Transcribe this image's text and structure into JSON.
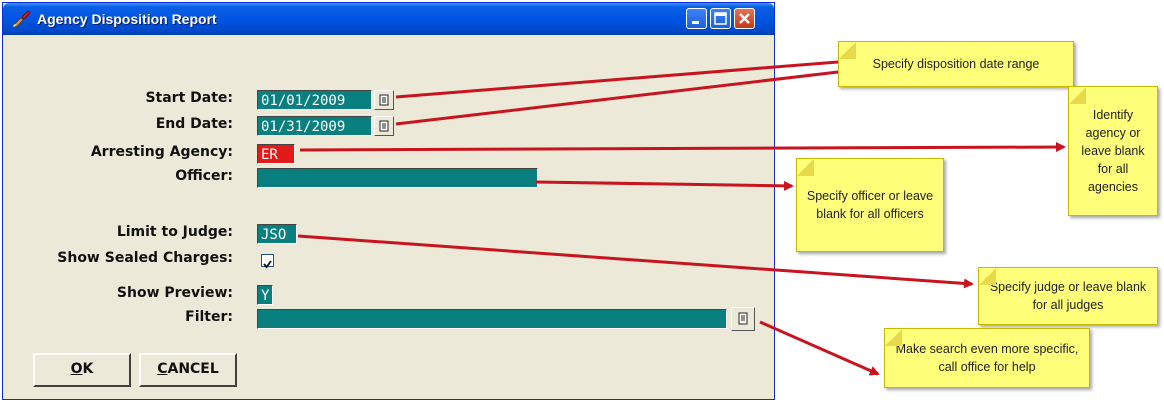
{
  "window": {
    "title": "Agency Disposition Report",
    "icon": "paintbrush-icon"
  },
  "form": {
    "start_date_label": "Start Date:",
    "start_date_value": "01/01/2009",
    "end_date_label": "End Date:",
    "end_date_value": "01/31/2009",
    "agency_label": "Arresting Agency:",
    "agency_value": "ER",
    "officer_label": "Officer:",
    "officer_value": "",
    "judge_label": "Limit to  Judge:",
    "judge_value": "JSO",
    "sealed_label": "Show Sealed Charges:",
    "sealed_checked": true,
    "preview_label": "Show Preview:",
    "preview_value": "Y",
    "filter_label": "Filter:",
    "filter_value": ""
  },
  "buttons": {
    "ok_accel": "O",
    "ok_rest": "K",
    "cancel_accel": "C",
    "cancel_rest": "ANCEL"
  },
  "notes": {
    "date_range": "Specify disposition date range",
    "agency": "Identify agency or leave blank for all agencies",
    "officer": "Specify officer or leave blank for all officers",
    "judge": "Specify judge or leave blank for all judges",
    "filter": "Make search even more specific, call office for help"
  },
  "colors": {
    "field_teal": "#0a7f7f",
    "agency_red": "#e21a1a",
    "note_yellow": "#ffff7a",
    "arrow_red": "#c8141e"
  }
}
